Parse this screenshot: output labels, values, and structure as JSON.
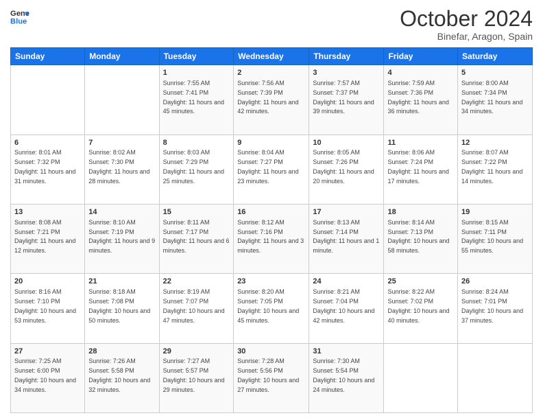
{
  "header": {
    "logo_line1": "General",
    "logo_line2": "Blue",
    "title": "October 2024",
    "subtitle": "Binefar, Aragon, Spain"
  },
  "days_of_week": [
    "Sunday",
    "Monday",
    "Tuesday",
    "Wednesday",
    "Thursday",
    "Friday",
    "Saturday"
  ],
  "weeks": [
    [
      {
        "day": "",
        "sunrise": "",
        "sunset": "",
        "daylight": ""
      },
      {
        "day": "",
        "sunrise": "",
        "sunset": "",
        "daylight": ""
      },
      {
        "day": "1",
        "sunrise": "Sunrise: 7:55 AM",
        "sunset": "Sunset: 7:41 PM",
        "daylight": "Daylight: 11 hours and 45 minutes."
      },
      {
        "day": "2",
        "sunrise": "Sunrise: 7:56 AM",
        "sunset": "Sunset: 7:39 PM",
        "daylight": "Daylight: 11 hours and 42 minutes."
      },
      {
        "day": "3",
        "sunrise": "Sunrise: 7:57 AM",
        "sunset": "Sunset: 7:37 PM",
        "daylight": "Daylight: 11 hours and 39 minutes."
      },
      {
        "day": "4",
        "sunrise": "Sunrise: 7:59 AM",
        "sunset": "Sunset: 7:36 PM",
        "daylight": "Daylight: 11 hours and 36 minutes."
      },
      {
        "day": "5",
        "sunrise": "Sunrise: 8:00 AM",
        "sunset": "Sunset: 7:34 PM",
        "daylight": "Daylight: 11 hours and 34 minutes."
      }
    ],
    [
      {
        "day": "6",
        "sunrise": "Sunrise: 8:01 AM",
        "sunset": "Sunset: 7:32 PM",
        "daylight": "Daylight: 11 hours and 31 minutes."
      },
      {
        "day": "7",
        "sunrise": "Sunrise: 8:02 AM",
        "sunset": "Sunset: 7:30 PM",
        "daylight": "Daylight: 11 hours and 28 minutes."
      },
      {
        "day": "8",
        "sunrise": "Sunrise: 8:03 AM",
        "sunset": "Sunset: 7:29 PM",
        "daylight": "Daylight: 11 hours and 25 minutes."
      },
      {
        "day": "9",
        "sunrise": "Sunrise: 8:04 AM",
        "sunset": "Sunset: 7:27 PM",
        "daylight": "Daylight: 11 hours and 23 minutes."
      },
      {
        "day": "10",
        "sunrise": "Sunrise: 8:05 AM",
        "sunset": "Sunset: 7:26 PM",
        "daylight": "Daylight: 11 hours and 20 minutes."
      },
      {
        "day": "11",
        "sunrise": "Sunrise: 8:06 AM",
        "sunset": "Sunset: 7:24 PM",
        "daylight": "Daylight: 11 hours and 17 minutes."
      },
      {
        "day": "12",
        "sunrise": "Sunrise: 8:07 AM",
        "sunset": "Sunset: 7:22 PM",
        "daylight": "Daylight: 11 hours and 14 minutes."
      }
    ],
    [
      {
        "day": "13",
        "sunrise": "Sunrise: 8:08 AM",
        "sunset": "Sunset: 7:21 PM",
        "daylight": "Daylight: 11 hours and 12 minutes."
      },
      {
        "day": "14",
        "sunrise": "Sunrise: 8:10 AM",
        "sunset": "Sunset: 7:19 PM",
        "daylight": "Daylight: 11 hours and 9 minutes."
      },
      {
        "day": "15",
        "sunrise": "Sunrise: 8:11 AM",
        "sunset": "Sunset: 7:17 PM",
        "daylight": "Daylight: 11 hours and 6 minutes."
      },
      {
        "day": "16",
        "sunrise": "Sunrise: 8:12 AM",
        "sunset": "Sunset: 7:16 PM",
        "daylight": "Daylight: 11 hours and 3 minutes."
      },
      {
        "day": "17",
        "sunrise": "Sunrise: 8:13 AM",
        "sunset": "Sunset: 7:14 PM",
        "daylight": "Daylight: 11 hours and 1 minute."
      },
      {
        "day": "18",
        "sunrise": "Sunrise: 8:14 AM",
        "sunset": "Sunset: 7:13 PM",
        "daylight": "Daylight: 10 hours and 58 minutes."
      },
      {
        "day": "19",
        "sunrise": "Sunrise: 8:15 AM",
        "sunset": "Sunset: 7:11 PM",
        "daylight": "Daylight: 10 hours and 55 minutes."
      }
    ],
    [
      {
        "day": "20",
        "sunrise": "Sunrise: 8:16 AM",
        "sunset": "Sunset: 7:10 PM",
        "daylight": "Daylight: 10 hours and 53 minutes."
      },
      {
        "day": "21",
        "sunrise": "Sunrise: 8:18 AM",
        "sunset": "Sunset: 7:08 PM",
        "daylight": "Daylight: 10 hours and 50 minutes."
      },
      {
        "day": "22",
        "sunrise": "Sunrise: 8:19 AM",
        "sunset": "Sunset: 7:07 PM",
        "daylight": "Daylight: 10 hours and 47 minutes."
      },
      {
        "day": "23",
        "sunrise": "Sunrise: 8:20 AM",
        "sunset": "Sunset: 7:05 PM",
        "daylight": "Daylight: 10 hours and 45 minutes."
      },
      {
        "day": "24",
        "sunrise": "Sunrise: 8:21 AM",
        "sunset": "Sunset: 7:04 PM",
        "daylight": "Daylight: 10 hours and 42 minutes."
      },
      {
        "day": "25",
        "sunrise": "Sunrise: 8:22 AM",
        "sunset": "Sunset: 7:02 PM",
        "daylight": "Daylight: 10 hours and 40 minutes."
      },
      {
        "day": "26",
        "sunrise": "Sunrise: 8:24 AM",
        "sunset": "Sunset: 7:01 PM",
        "daylight": "Daylight: 10 hours and 37 minutes."
      }
    ],
    [
      {
        "day": "27",
        "sunrise": "Sunrise: 7:25 AM",
        "sunset": "Sunset: 6:00 PM",
        "daylight": "Daylight: 10 hours and 34 minutes."
      },
      {
        "day": "28",
        "sunrise": "Sunrise: 7:26 AM",
        "sunset": "Sunset: 5:58 PM",
        "daylight": "Daylight: 10 hours and 32 minutes."
      },
      {
        "day": "29",
        "sunrise": "Sunrise: 7:27 AM",
        "sunset": "Sunset: 5:57 PM",
        "daylight": "Daylight: 10 hours and 29 minutes."
      },
      {
        "day": "30",
        "sunrise": "Sunrise: 7:28 AM",
        "sunset": "Sunset: 5:56 PM",
        "daylight": "Daylight: 10 hours and 27 minutes."
      },
      {
        "day": "31",
        "sunrise": "Sunrise: 7:30 AM",
        "sunset": "Sunset: 5:54 PM",
        "daylight": "Daylight: 10 hours and 24 minutes."
      },
      {
        "day": "",
        "sunrise": "",
        "sunset": "",
        "daylight": ""
      },
      {
        "day": "",
        "sunrise": "",
        "sunset": "",
        "daylight": ""
      }
    ]
  ]
}
